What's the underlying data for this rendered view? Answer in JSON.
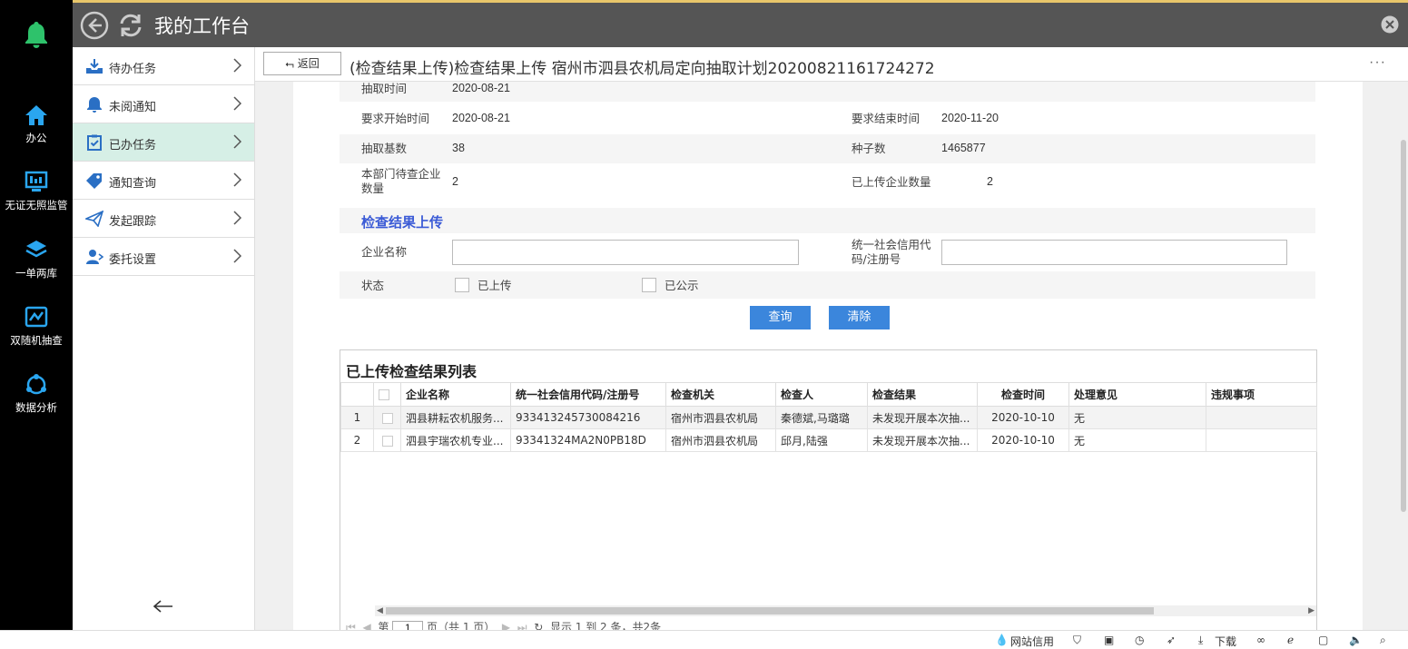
{
  "header": {
    "title": "我的工作台"
  },
  "rail": {
    "items": [
      {
        "label": "办公"
      },
      {
        "label": "无证无照监管"
      },
      {
        "label": "一单两库"
      },
      {
        "label": "双随机抽查"
      },
      {
        "label": "数据分析"
      }
    ]
  },
  "sidemenu": {
    "items": [
      {
        "label": "待办任务"
      },
      {
        "label": "未阅通知"
      },
      {
        "label": "已办任务"
      },
      {
        "label": "通知查询"
      },
      {
        "label": "发起跟踪"
      },
      {
        "label": "委托设置"
      }
    ]
  },
  "tabbar": {
    "back_label": "返回",
    "page_title": "(检查结果上传)检查结果上传 宿州市泗县农机局定向抽取计划20200821161724272",
    "more": "···"
  },
  "form": {
    "extract_time_label": "抽取时间",
    "extract_time_value": "2020-08-21",
    "start_label": "要求开始时间",
    "start_value": "2020-08-21",
    "end_label": "要求结束时间",
    "end_value": "2020-11-20",
    "base_label": "抽取基数",
    "base_value": "38",
    "seed_label": "种子数",
    "seed_value": "1465877",
    "pending_label": "本部门待查企业数量",
    "pending_value": "2",
    "uploaded_label": "已上传企业数量",
    "uploaded_value": "2"
  },
  "upload_section": {
    "title": "检查结果上传",
    "company_label": "企业名称",
    "company_value": "",
    "credit_label": "统一社会信用代码/注册号",
    "credit_value": "",
    "status_label": "状态",
    "opt_uploaded": "已上传",
    "opt_published": "已公示",
    "query_btn": "查询",
    "clear_btn": "清除"
  },
  "grid": {
    "title": "已上传检查结果列表",
    "columns": [
      "企业名称",
      "统一社会信用代码/注册号",
      "检查机关",
      "检查人",
      "检查结果",
      "检查时间",
      "处理意见",
      "违规事项"
    ],
    "rows": [
      {
        "num": "1",
        "company": "泗县耕耘农机服务...",
        "code": "933413245730084216",
        "org": "宿州市泗县农机局",
        "inspector": "秦德斌,马璐璐",
        "result": "未发现开展本次抽...",
        "time": "2020-10-10",
        "opinion": "无",
        "violation": ""
      },
      {
        "num": "2",
        "company": "泗县宇瑞农机专业...",
        "code": "93341324MA2N0PB18D",
        "org": "宿州市泗县农机局",
        "inspector": "邱月,陆强",
        "result": "未发现开展本次抽...",
        "time": "2020-10-10",
        "opinion": "无",
        "violation": ""
      }
    ],
    "pager": {
      "page_prefix": "第",
      "page_value": "1",
      "page_suffix": "页（共 1 页）",
      "summary": "显示 1 到 2 条，共2条"
    }
  },
  "statusbar": {
    "site_credit": "网站信用",
    "download": "下载"
  }
}
